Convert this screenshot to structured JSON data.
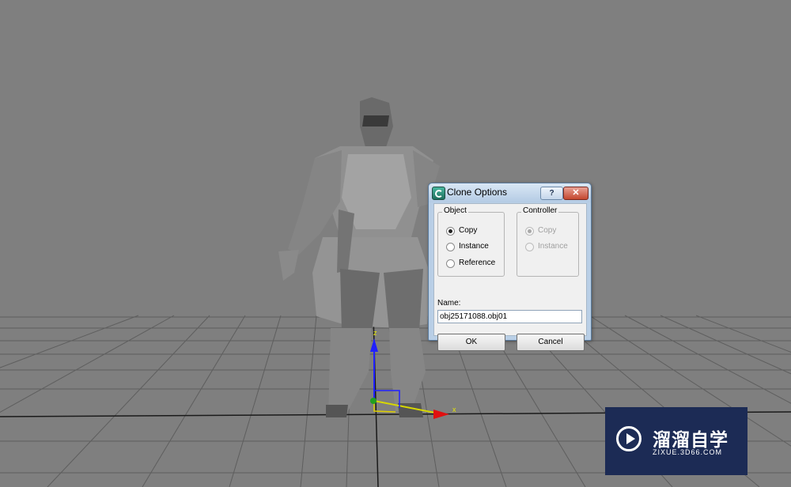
{
  "dialog": {
    "title": "Clone Options",
    "help_label": "?",
    "close_label": "✕",
    "object_group": {
      "label": "Object",
      "options": [
        {
          "label": "Copy",
          "checked": true
        },
        {
          "label": "Instance",
          "checked": false
        },
        {
          "label": "Reference",
          "checked": false
        }
      ]
    },
    "controller_group": {
      "label": "Controller",
      "options": [
        {
          "label": "Copy",
          "checked": true,
          "disabled": true
        },
        {
          "label": "Instance",
          "checked": false,
          "disabled": true
        }
      ]
    },
    "name_label": "Name:",
    "name_value": "obj25171088.obj01",
    "ok_label": "OK",
    "cancel_label": "Cancel"
  },
  "viewport": {
    "gizmo_z_label": "z",
    "gizmo_x_label": "x"
  },
  "watermark": {
    "title": "溜溜自学",
    "url": "ZIXUE.3D66.COM"
  }
}
